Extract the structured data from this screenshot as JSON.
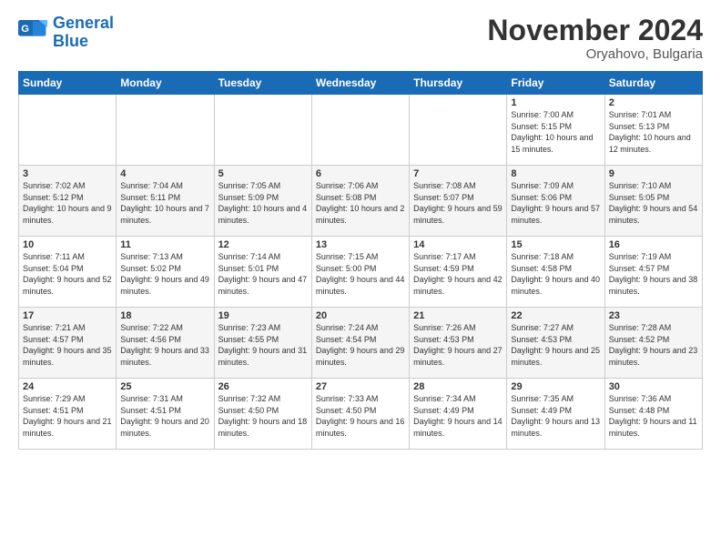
{
  "logo": {
    "line1": "General",
    "line2": "Blue"
  },
  "title": "November 2024",
  "location": "Oryahovo, Bulgaria",
  "weekdays": [
    "Sunday",
    "Monday",
    "Tuesday",
    "Wednesday",
    "Thursday",
    "Friday",
    "Saturday"
  ],
  "weeks": [
    [
      {
        "day": "",
        "info": ""
      },
      {
        "day": "",
        "info": ""
      },
      {
        "day": "",
        "info": ""
      },
      {
        "day": "",
        "info": ""
      },
      {
        "day": "",
        "info": ""
      },
      {
        "day": "1",
        "info": "Sunrise: 7:00 AM\nSunset: 5:15 PM\nDaylight: 10 hours and 15 minutes."
      },
      {
        "day": "2",
        "info": "Sunrise: 7:01 AM\nSunset: 5:13 PM\nDaylight: 10 hours and 12 minutes."
      }
    ],
    [
      {
        "day": "3",
        "info": "Sunrise: 7:02 AM\nSunset: 5:12 PM\nDaylight: 10 hours and 9 minutes."
      },
      {
        "day": "4",
        "info": "Sunrise: 7:04 AM\nSunset: 5:11 PM\nDaylight: 10 hours and 7 minutes."
      },
      {
        "day": "5",
        "info": "Sunrise: 7:05 AM\nSunset: 5:09 PM\nDaylight: 10 hours and 4 minutes."
      },
      {
        "day": "6",
        "info": "Sunrise: 7:06 AM\nSunset: 5:08 PM\nDaylight: 10 hours and 2 minutes."
      },
      {
        "day": "7",
        "info": "Sunrise: 7:08 AM\nSunset: 5:07 PM\nDaylight: 9 hours and 59 minutes."
      },
      {
        "day": "8",
        "info": "Sunrise: 7:09 AM\nSunset: 5:06 PM\nDaylight: 9 hours and 57 minutes."
      },
      {
        "day": "9",
        "info": "Sunrise: 7:10 AM\nSunset: 5:05 PM\nDaylight: 9 hours and 54 minutes."
      }
    ],
    [
      {
        "day": "10",
        "info": "Sunrise: 7:11 AM\nSunset: 5:04 PM\nDaylight: 9 hours and 52 minutes."
      },
      {
        "day": "11",
        "info": "Sunrise: 7:13 AM\nSunset: 5:02 PM\nDaylight: 9 hours and 49 minutes."
      },
      {
        "day": "12",
        "info": "Sunrise: 7:14 AM\nSunset: 5:01 PM\nDaylight: 9 hours and 47 minutes."
      },
      {
        "day": "13",
        "info": "Sunrise: 7:15 AM\nSunset: 5:00 PM\nDaylight: 9 hours and 44 minutes."
      },
      {
        "day": "14",
        "info": "Sunrise: 7:17 AM\nSunset: 4:59 PM\nDaylight: 9 hours and 42 minutes."
      },
      {
        "day": "15",
        "info": "Sunrise: 7:18 AM\nSunset: 4:58 PM\nDaylight: 9 hours and 40 minutes."
      },
      {
        "day": "16",
        "info": "Sunrise: 7:19 AM\nSunset: 4:57 PM\nDaylight: 9 hours and 38 minutes."
      }
    ],
    [
      {
        "day": "17",
        "info": "Sunrise: 7:21 AM\nSunset: 4:57 PM\nDaylight: 9 hours and 35 minutes."
      },
      {
        "day": "18",
        "info": "Sunrise: 7:22 AM\nSunset: 4:56 PM\nDaylight: 9 hours and 33 minutes."
      },
      {
        "day": "19",
        "info": "Sunrise: 7:23 AM\nSunset: 4:55 PM\nDaylight: 9 hours and 31 minutes."
      },
      {
        "day": "20",
        "info": "Sunrise: 7:24 AM\nSunset: 4:54 PM\nDaylight: 9 hours and 29 minutes."
      },
      {
        "day": "21",
        "info": "Sunrise: 7:26 AM\nSunset: 4:53 PM\nDaylight: 9 hours and 27 minutes."
      },
      {
        "day": "22",
        "info": "Sunrise: 7:27 AM\nSunset: 4:53 PM\nDaylight: 9 hours and 25 minutes."
      },
      {
        "day": "23",
        "info": "Sunrise: 7:28 AM\nSunset: 4:52 PM\nDaylight: 9 hours and 23 minutes."
      }
    ],
    [
      {
        "day": "24",
        "info": "Sunrise: 7:29 AM\nSunset: 4:51 PM\nDaylight: 9 hours and 21 minutes."
      },
      {
        "day": "25",
        "info": "Sunrise: 7:31 AM\nSunset: 4:51 PM\nDaylight: 9 hours and 20 minutes."
      },
      {
        "day": "26",
        "info": "Sunrise: 7:32 AM\nSunset: 4:50 PM\nDaylight: 9 hours and 18 minutes."
      },
      {
        "day": "27",
        "info": "Sunrise: 7:33 AM\nSunset: 4:50 PM\nDaylight: 9 hours and 16 minutes."
      },
      {
        "day": "28",
        "info": "Sunrise: 7:34 AM\nSunset: 4:49 PM\nDaylight: 9 hours and 14 minutes."
      },
      {
        "day": "29",
        "info": "Sunrise: 7:35 AM\nSunset: 4:49 PM\nDaylight: 9 hours and 13 minutes."
      },
      {
        "day": "30",
        "info": "Sunrise: 7:36 AM\nSunset: 4:48 PM\nDaylight: 9 hours and 11 minutes."
      }
    ]
  ]
}
